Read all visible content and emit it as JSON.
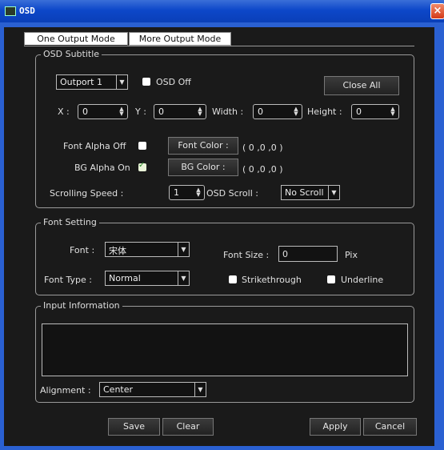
{
  "window": {
    "title": "OSD",
    "close_glyph": "×"
  },
  "tabs": [
    {
      "label": "One Output Mode",
      "active": true
    },
    {
      "label": "More Output Mode",
      "active": false
    }
  ],
  "osd_subtitle": {
    "title": "OSD Subtitle",
    "output_select": "Outport 1",
    "osd_off_label": "OSD Off",
    "close_all": "Close All",
    "x_label": "X :",
    "x_value": "0",
    "y_label": "Y :",
    "y_value": "0",
    "width_label": "Width :",
    "width_value": "0",
    "height_label": "Height :",
    "height_value": "0",
    "font_alpha_label": "Font Alpha Off",
    "bg_alpha_label": "BG Alpha On",
    "font_color_button": "Font Color :",
    "font_color_value": "( 0 ,0 ,0 )",
    "bg_color_button": "BG Color :",
    "bg_color_value": "( 0 ,0 ,0 )",
    "scrolling_speed_label": "Scrolling Speed :",
    "scrolling_speed_value": "1",
    "osd_scroll_label": "OSD Scroll :",
    "osd_scroll_value": "No Scroll"
  },
  "font_setting": {
    "title": "Font Setting",
    "font_label": "Font :",
    "font_value": "宋体",
    "font_size_label": "Font Size :",
    "font_size_value": "0",
    "pix_label": "Pix",
    "font_type_label": "Font Type :",
    "font_type_value": "Normal",
    "strikethrough_label": "Strikethrough",
    "underline_label": "Underline"
  },
  "input_information": {
    "title": "Input Information",
    "text": "",
    "alignment_label": "Alignment :",
    "alignment_value": "Center"
  },
  "footer": {
    "save": "Save",
    "clear": "Clear",
    "apply": "Apply",
    "cancel": "Cancel"
  }
}
